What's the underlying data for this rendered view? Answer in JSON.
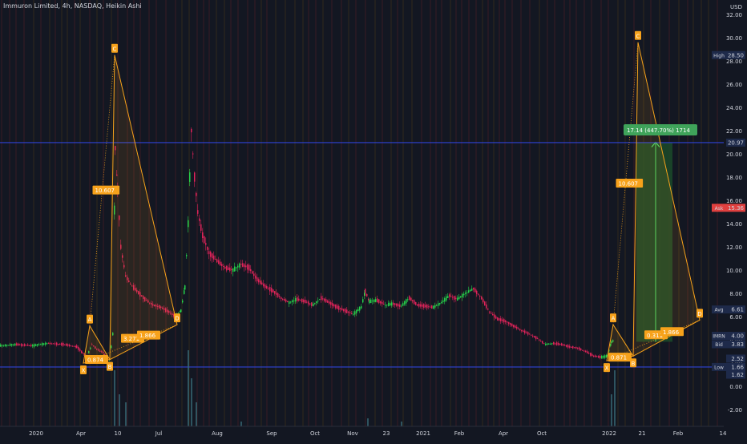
{
  "header": {
    "title": "Immuron Limited, 4h, NASDAQ, Heikin Ashi",
    "currency": "USD"
  },
  "colors": {
    "background": "#131722",
    "bull": "#26d14a",
    "bear": "#e0235a",
    "pattern": "#f7a21b",
    "hline": "#2f43d6",
    "target_fill": "#1b4d2a",
    "target_label": "#3fa35a",
    "price_axis_label": "#1e2a4a",
    "ask_label": "#e0403f"
  },
  "chart_data": {
    "type": "candlestick",
    "title": "Immuron Limited, 4h, NASDAQ, Heikin Ashi",
    "y_axis": {
      "ticks": [
        32.0,
        30.0,
        28.0,
        26.0,
        24.0,
        22.0,
        20.0,
        18.0,
        16.0,
        14.0,
        12.0,
        10.0,
        8.0,
        6.0,
        4.0,
        2.0,
        0.0,
        -2.0
      ],
      "tick_labels": [
        "32.00",
        "30.00",
        "28.00",
        "26.00",
        "24.00",
        "22.00",
        "20.00",
        "18.00",
        "16.00",
        "14.00",
        "12.00",
        "10.00",
        "8.00",
        "6.00",
        "4.00",
        "2.00",
        "0.00",
        "-2.00"
      ],
      "range": [
        -3.2,
        32.6
      ]
    },
    "x_axis": {
      "tick_labels": [
        "2020",
        "Apr",
        "10",
        "Jul",
        "Aug",
        "Sep",
        "Oct",
        "Nov",
        "23",
        "2021",
        "Feb",
        "Apr",
        "Oct",
        "2022",
        "21",
        "Feb",
        "14"
      ]
    },
    "price_labels": [
      {
        "name": "High",
        "value": "28.50"
      },
      {
        "name": "",
        "value": "20.97"
      },
      {
        "name": "Ask",
        "value": "15.36"
      },
      {
        "name": "Avg",
        "value": "6.61"
      },
      {
        "name": "IMRN",
        "value": "4.00"
      },
      {
        "name": "Bid",
        "value": "3.83"
      },
      {
        "name": "",
        "value": "2.52"
      },
      {
        "name": "Low",
        "value": "1.66"
      },
      {
        "name": "",
        "value": "1.62"
      }
    ],
    "horizontal_lines": [
      20.97,
      1.66
    ],
    "price_path": [
      [
        0,
        3.5
      ],
      [
        20,
        3.6
      ],
      [
        40,
        3.5
      ],
      [
        60,
        3.7
      ],
      [
        80,
        3.6
      ],
      [
        95,
        3.4
      ],
      [
        102,
        2.9
      ],
      [
        108,
        2.6
      ],
      [
        114,
        3.6
      ],
      [
        120,
        3.2
      ],
      [
        128,
        2.9
      ],
      [
        136,
        2.3
      ],
      [
        140,
        4.5
      ],
      [
        143,
        20.5
      ],
      [
        146,
        17
      ],
      [
        150,
        12
      ],
      [
        156,
        9.5
      ],
      [
        162,
        8.8
      ],
      [
        170,
        8.2
      ],
      [
        180,
        7.5
      ],
      [
        190,
        7.0
      ],
      [
        200,
        6.8
      ],
      [
        210,
        6.4
      ],
      [
        218,
        6.0
      ],
      [
        225,
        6.5
      ],
      [
        230,
        8.5
      ],
      [
        234,
        14
      ],
      [
        238,
        22
      ],
      [
        242,
        18
      ],
      [
        246,
        15
      ],
      [
        252,
        13
      ],
      [
        260,
        11.5
      ],
      [
        270,
        10.8
      ],
      [
        280,
        10.2
      ],
      [
        290,
        10.0
      ],
      [
        300,
        10.5
      ],
      [
        310,
        10.2
      ],
      [
        320,
        9.2
      ],
      [
        330,
        8.6
      ],
      [
        340,
        8.2
      ],
      [
        350,
        7.6
      ],
      [
        360,
        7.2
      ],
      [
        370,
        7.5
      ],
      [
        380,
        7.3
      ],
      [
        390,
        7.0
      ],
      [
        400,
        7.6
      ],
      [
        410,
        7.2
      ],
      [
        420,
        6.8
      ],
      [
        430,
        6.5
      ],
      [
        440,
        6.2
      ],
      [
        450,
        6.8
      ],
      [
        455,
        8.2
      ],
      [
        460,
        7.3
      ],
      [
        470,
        7.4
      ],
      [
        480,
        7.0
      ],
      [
        490,
        7.1
      ],
      [
        500,
        6.9
      ],
      [
        510,
        7.6
      ],
      [
        520,
        7.0
      ],
      [
        530,
        6.9
      ],
      [
        540,
        6.8
      ],
      [
        550,
        7.2
      ],
      [
        560,
        7.8
      ],
      [
        570,
        7.5
      ],
      [
        580,
        8.0
      ],
      [
        590,
        8.4
      ],
      [
        600,
        7.6
      ],
      [
        610,
        6.4
      ],
      [
        620,
        5.8
      ],
      [
        630,
        5.6
      ],
      [
        640,
        5.2
      ],
      [
        650,
        4.8
      ],
      [
        660,
        4.5
      ],
      [
        670,
        4.1
      ],
      [
        680,
        3.6
      ],
      [
        690,
        3.7
      ],
      [
        700,
        3.6
      ],
      [
        710,
        3.4
      ],
      [
        720,
        3.3
      ],
      [
        730,
        3.0
      ],
      [
        740,
        2.6
      ],
      [
        750,
        2.5
      ],
      [
        757,
        2.6
      ],
      [
        762,
        3.8
      ],
      [
        766,
        4.0
      ]
    ],
    "harmonic_patterns": [
      {
        "points": {
          "X": 2.0,
          "A": 5.2,
          "B": 2.3,
          "C": 28.5,
          "D": 5.3
        },
        "labels": {
          "XB": "0.874",
          "AC": "10.607",
          "XD": "3.271",
          "BD": "1.866"
        }
      },
      {
        "points": {
          "X": 2.2,
          "A": 5.3,
          "B": 2.6,
          "C": 29.6,
          "D": 5.7
        },
        "labels": {
          "XB": "0.871",
          "AC": "10.607",
          "XD": "0.311",
          "BD": "1.866"
        }
      }
    ],
    "target_label": "17.14 (447.70%) 1714",
    "target_range": [
      3.83,
      21.0
    ],
    "grid": false,
    "legend": "none"
  }
}
